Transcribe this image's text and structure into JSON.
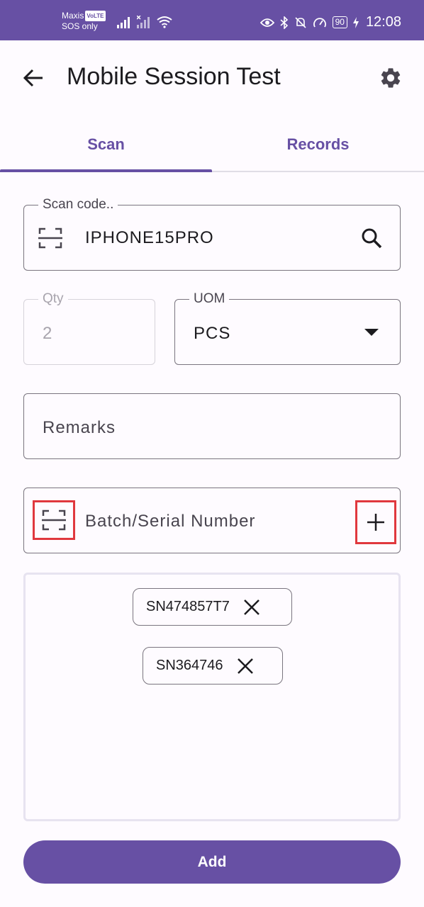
{
  "status_bar": {
    "carrier": "Maxis",
    "volte": "VoLTE",
    "sos": "SOS only",
    "battery": "90",
    "time": "12:08"
  },
  "app_bar": {
    "title": "Mobile Session Test",
    "back_icon": "arrow-back-icon",
    "settings_icon": "gear-icon"
  },
  "tabs": [
    {
      "label": "Scan",
      "active": true
    },
    {
      "label": "Records",
      "active": false
    }
  ],
  "scan_field": {
    "label": "Scan code..",
    "value": "IPHONE15PRO",
    "leading_icon": "barcode-scan-icon",
    "trailing_icon": "search-icon"
  },
  "qty_field": {
    "label": "Qty",
    "value": "2",
    "disabled": true
  },
  "uom_field": {
    "label": "UOM",
    "value": "PCS",
    "trailing_icon": "dropdown-arrow-icon"
  },
  "remarks_field": {
    "placeholder": "Remarks"
  },
  "batch_field": {
    "placeholder": "Batch/Serial Number",
    "leading_icon": "barcode-scan-icon",
    "trailing_icon": "plus-icon"
  },
  "serial_chips": [
    {
      "label": "SN474857T7"
    },
    {
      "label": "SN364746"
    }
  ],
  "add_button": {
    "label": "Add"
  },
  "colors": {
    "primary": "#6750a4",
    "highlight": "#e0383e",
    "background": "#fefbff"
  }
}
